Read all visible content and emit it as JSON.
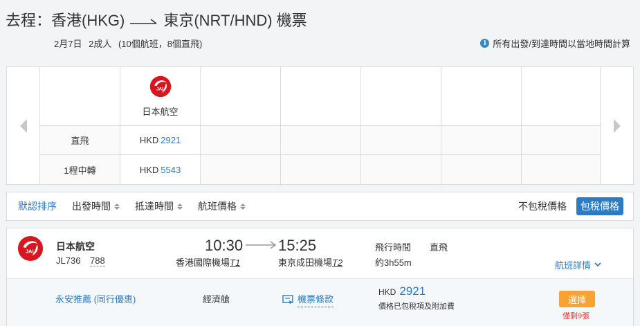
{
  "header": {
    "title_prefix": "去程：香港(HKG)",
    "title_suffix": "東京(NRT/HND) 機票",
    "date": "2月7日",
    "passengers": "2成人",
    "summary": "(10個航班，8個直飛)",
    "notice": "所有出發/到達時間以當地時間計算"
  },
  "matrix": {
    "airline_name": "日本航空",
    "logo_text": "JAL",
    "rows": [
      {
        "label": "直飛",
        "currency": "HKD",
        "price": "2921"
      },
      {
        "label": "1程中轉",
        "currency": "HKD",
        "price": "5543"
      }
    ]
  },
  "sortbar": {
    "default_sort": "默認排序",
    "depart_time": "出發時間",
    "arrive_time": "抵達時間",
    "price": "航班價格",
    "tax_excluded": "不包稅價格",
    "tax_included": "包稅價格"
  },
  "flight": {
    "airline": "日本航空",
    "flight_no": "JL736",
    "aircraft": "788",
    "dep_time": "10:30",
    "arr_time": "15:25",
    "dep_airport": "香港國際機場",
    "dep_terminal": "T1",
    "arr_airport": "東京成田機場",
    "arr_terminal": "T2",
    "duration_label": "飛行時間",
    "flight_type": "直飛",
    "duration": "約3h55m",
    "details_link": "航班詳情",
    "fare": {
      "promo": "永安推薦 (同行優惠)",
      "cabin": "經濟艙",
      "rules": "機票條款",
      "currency": "HKD",
      "price": "2921",
      "price_note": "價格已包稅項及附加費",
      "select": "選擇",
      "seats_left": "僅剩9張"
    }
  },
  "colors": {
    "accent": "#2b7cc4",
    "jal_red": "#d7171f",
    "button": "#f7a233",
    "warning": "#e23a3a"
  }
}
